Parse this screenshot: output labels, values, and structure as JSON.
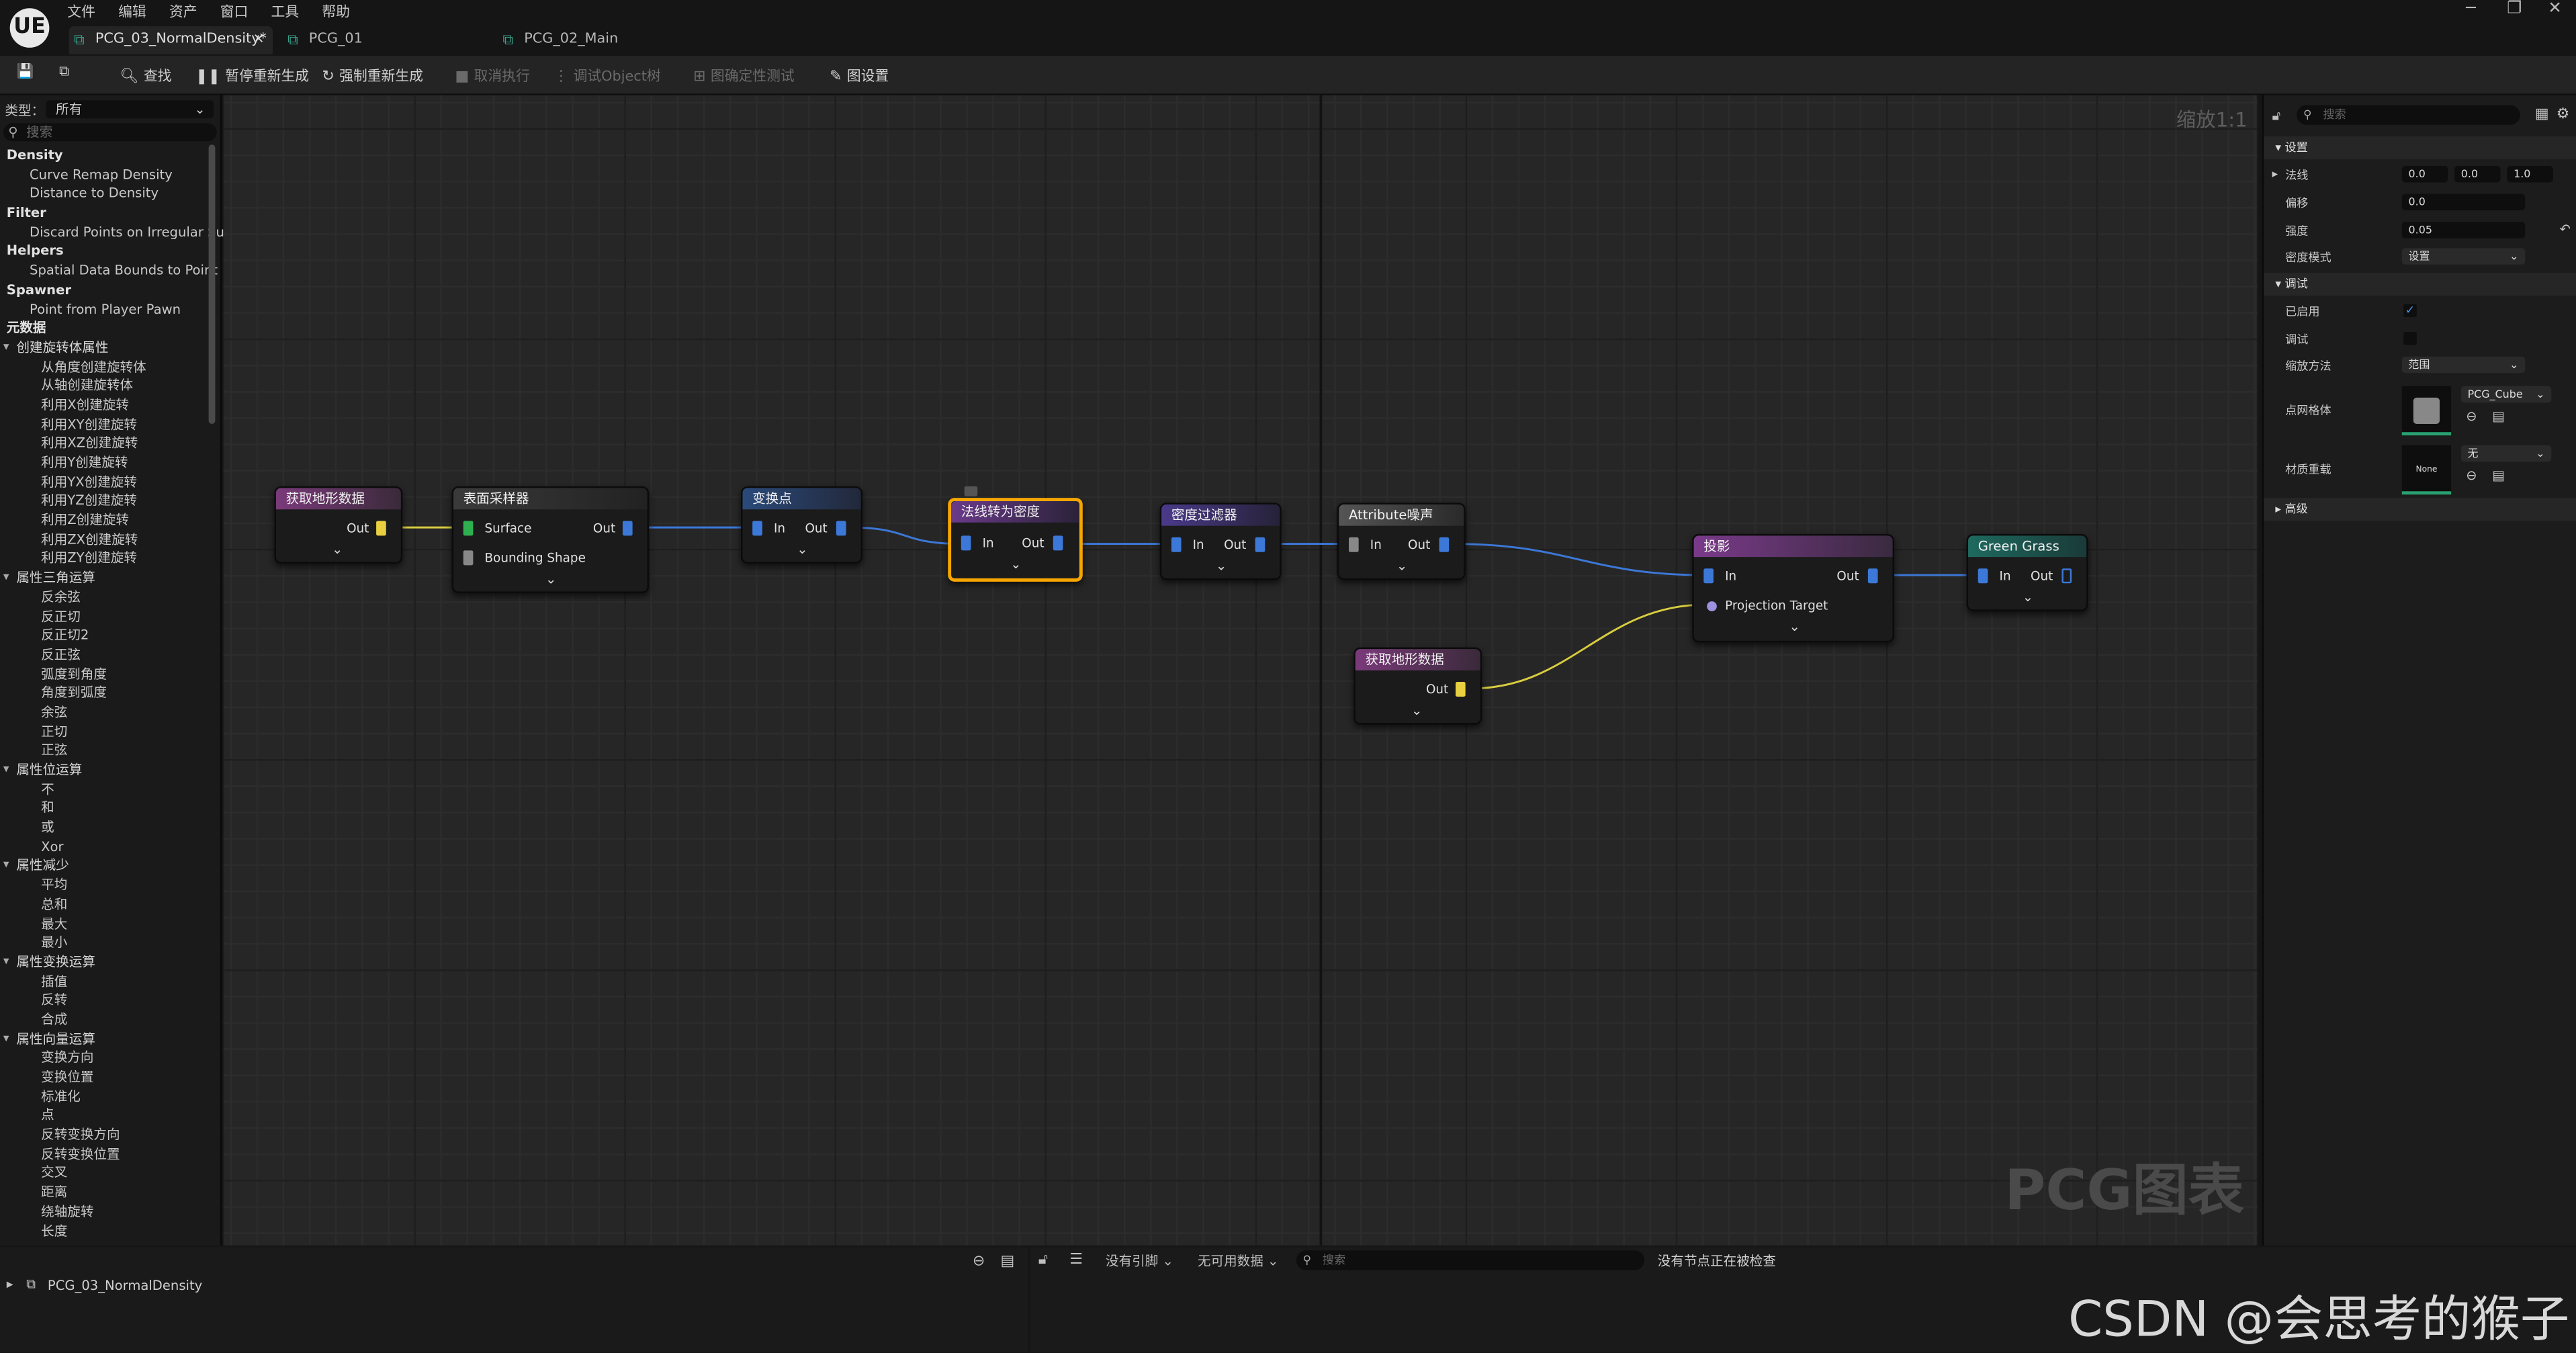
{
  "app": {
    "logo": "UE"
  },
  "menu": [
    "文件",
    "编辑",
    "资产",
    "窗口",
    "工具",
    "帮助"
  ],
  "window_controls": [
    "─",
    "❐",
    "✕"
  ],
  "tabs": [
    {
      "label": "PCG_03_NormalDensity*",
      "close": "×"
    },
    {
      "label": "PCG_01"
    },
    {
      "label": "PCG_02_Main"
    }
  ],
  "toolbar": {
    "find": "查找",
    "pause": "暂停重新生成",
    "force": "强制重新生成",
    "cancel": "取消执行",
    "debug_obj": "调试Object树",
    "determinism": "图确定性测试",
    "graph_settings": "图设置"
  },
  "left": {
    "type_label": "类型：",
    "type_value": "所有",
    "search_placeholder": "搜索",
    "tree": [
      "Density",
      "Curve Remap Density",
      "Distance to Density",
      "Filter",
      "Discard Points on Irregular Su",
      "Helpers",
      "Spatial Data Bounds to Point",
      "Spawner",
      "Point from Player Pawn",
      "元数据",
      "创建旋转体属性",
      "从角度创建旋转体",
      "从轴创建旋转体",
      "利用X创建旋转",
      "利用XY创建旋转",
      "利用XZ创建旋转",
      "利用Y创建旋转",
      "利用YX创建旋转",
      "利用YZ创建旋转",
      "利用Z创建旋转",
      "利用ZX创建旋转",
      "利用ZY创建旋转",
      "属性三角运算",
      "反余弦",
      "反正切",
      "反正切2",
      "反正弦",
      "弧度到角度",
      "角度到弧度",
      "余弦",
      "正切",
      "正弦",
      "属性位运算",
      "不",
      "和",
      "或",
      "Xor",
      "属性减少",
      "平均",
      "总和",
      "最大",
      "最小",
      "属性变换运算",
      "插值",
      "反转",
      "合成",
      "属性向量运算",
      "变换方向",
      "变换位置",
      "标准化",
      "点",
      "反转变换方向",
      "反转变换位置",
      "交叉",
      "距离",
      "绕轴旋转",
      "长度"
    ]
  },
  "graph": {
    "zoom": "缩放1:1",
    "watermark": "PCG图表",
    "nodes": {
      "n1": {
        "title": "获取地形数据",
        "out": "Out"
      },
      "n2": {
        "title": "表面采样器",
        "in1": "Surface",
        "in2": "Bounding Shape",
        "out": "Out"
      },
      "n3": {
        "title": "变换点",
        "in": "In",
        "out": "Out"
      },
      "n4": {
        "title": "法线转为密度",
        "in": "In",
        "out": "Out"
      },
      "n5": {
        "title": "密度过滤器",
        "in": "In",
        "out": "Out"
      },
      "n6": {
        "title": "Attribute噪声",
        "in": "In",
        "out": "Out"
      },
      "n7": {
        "title": "获取地形数据",
        "out": "Out"
      },
      "n8": {
        "title": "投影",
        "in": "In",
        "in2": "Projection Target",
        "out": "Out"
      },
      "n9": {
        "title": "Green Grass",
        "in": "In",
        "out": "Out"
      }
    }
  },
  "right": {
    "search_placeholder": "搜索",
    "sec_settings": "设置",
    "normal": "法线",
    "normal_x": "0.0",
    "normal_y": "0.0",
    "normal_z": "1.0",
    "offset": "偏移",
    "offset_v": "0.0",
    "strength": "强度",
    "strength_v": "0.05",
    "density_mode": "密度模式",
    "density_mode_v": "设置",
    "sec_debug": "调试",
    "enabled": "已启用",
    "debug": "调试",
    "scale_method": "缩放方法",
    "scale_method_v": "范围",
    "point_mesh": "点网格体",
    "point_mesh_v": "PCG_Cube",
    "mat_override": "材质重载",
    "mat_v": "无",
    "mat_thumb": "None",
    "advanced": "高级"
  },
  "bottom": {
    "tree_item": "PCG_03_NormalDensity",
    "no_ref": "没有引脚",
    "no_data": "无可用数据",
    "search_placeholder": "搜索",
    "status": "没有节点正在被检查"
  },
  "overlay": {
    "csdn": "CSDN @会思考的猴子"
  }
}
